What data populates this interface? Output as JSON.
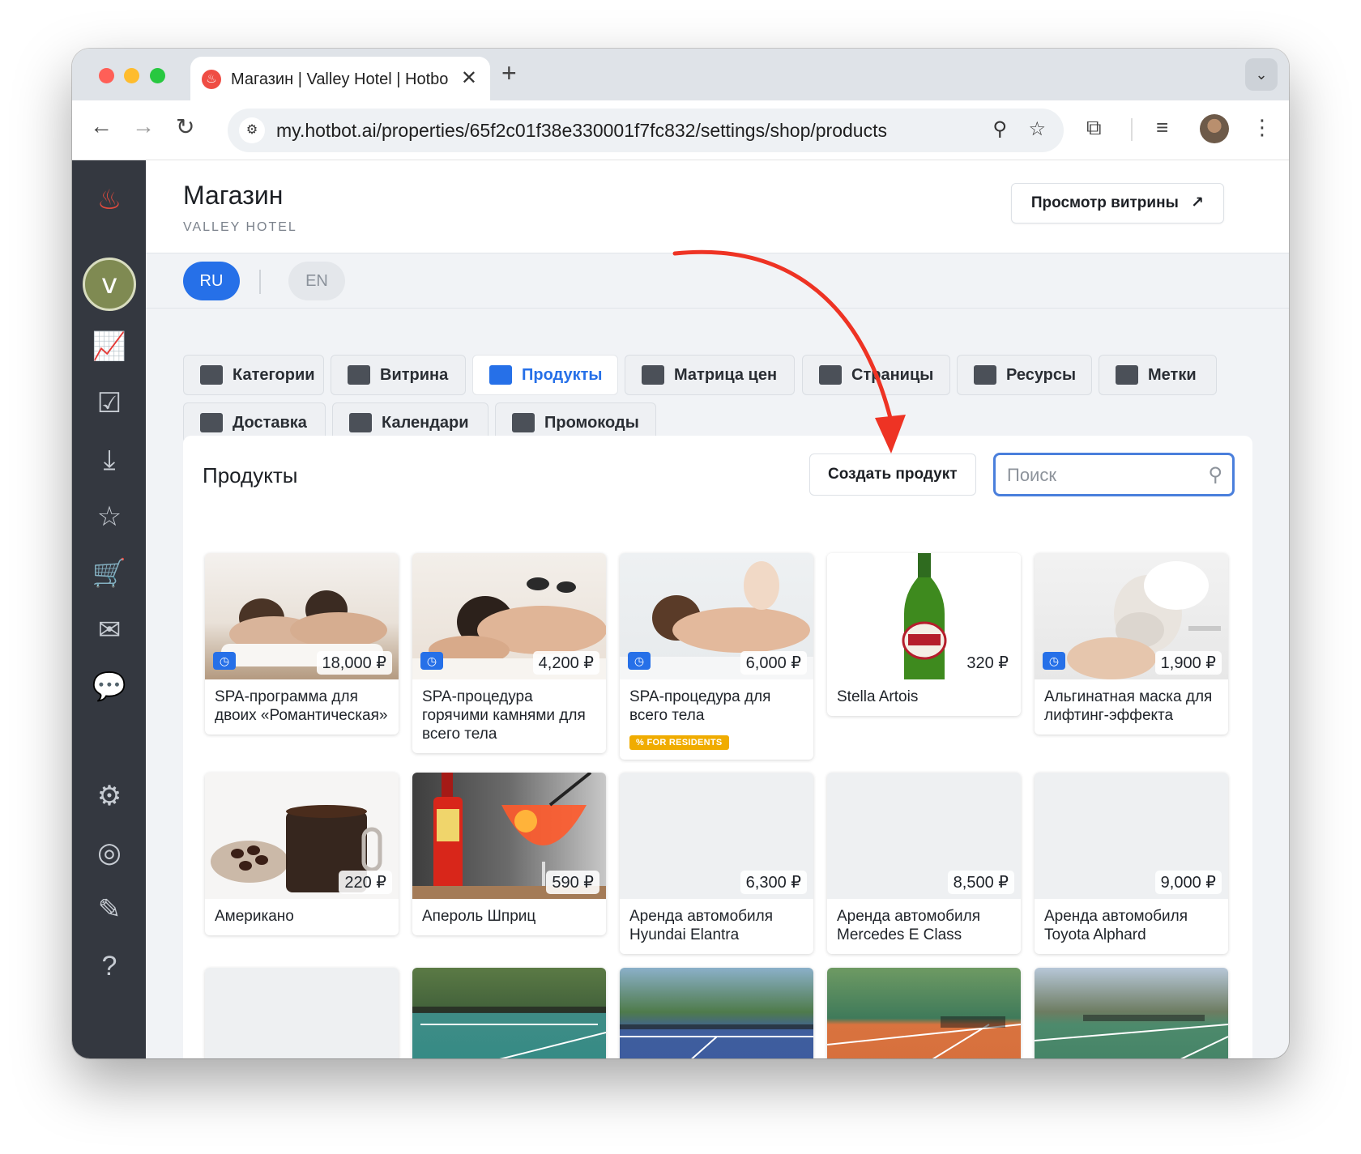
{
  "browser": {
    "tab_title": "Магазин | Valley Hotel | Hotbot",
    "url": "my.hotbot.ai/properties/65f2c01f38e330001f7fc832/settings/shop/products"
  },
  "page": {
    "title": "Магазин",
    "subtitle": "VALLEY HOTEL",
    "preview_button": "Просмотр витрины",
    "preview_arrow": "↗"
  },
  "languages": {
    "ru": "RU",
    "en": "EN"
  },
  "nav_tabs": [
    {
      "label": "Категории",
      "icon": "store-icon"
    },
    {
      "label": "Витрина",
      "icon": "showcase-icon"
    },
    {
      "label": "Продукты",
      "icon": "products-icon"
    },
    {
      "label": "Матрица цен",
      "icon": "price-matrix-icon"
    },
    {
      "label": "Страницы",
      "icon": "pages-icon"
    },
    {
      "label": "Ресурсы",
      "icon": "resources-icon"
    },
    {
      "label": "Метки",
      "icon": "tag-icon"
    },
    {
      "label": "Доставка",
      "icon": "truck-icon"
    },
    {
      "label": "Календари",
      "icon": "calendar-icon"
    },
    {
      "label": "Промокоды",
      "icon": "promo-icon"
    }
  ],
  "products_panel": {
    "title": "Продукты",
    "create_button": "Создать продукт",
    "search_placeholder": "Поиск"
  },
  "products": [
    {
      "name": "SPA-программа для двоих «Романтическая»",
      "price": "18,000 ₽",
      "timed": true,
      "image": "spa-couple"
    },
    {
      "name": "SPA-процедура горячими камнями для всего тела",
      "price": "4,200 ₽",
      "timed": true,
      "image": "hot-stones"
    },
    {
      "name": "SPA-процедура для всего тела",
      "price": "6,000 ₽",
      "timed": true,
      "badge": "FOR RESIDENTS",
      "image": "massage"
    },
    {
      "name": "Stella Artois",
      "price": "320 ₽",
      "timed": false,
      "image": "beer"
    },
    {
      "name": "Альгинатная маска для лифтинг-эффекта",
      "price": "1,900 ₽",
      "timed": true,
      "image": "face-mask"
    },
    {
      "name": "Американо",
      "price": "220 ₽",
      "timed": false,
      "image": "coffee"
    },
    {
      "name": "Апероль Шприц",
      "price": "590 ₽",
      "timed": false,
      "image": "aperol"
    },
    {
      "name": "Аренда автомобиля Hyundai Elantra",
      "price": "6,300 ₽",
      "timed": false,
      "image": "empty"
    },
    {
      "name": "Аренда автомобиля Mercedes E Class",
      "price": "8,500 ₽",
      "timed": false,
      "image": "empty"
    },
    {
      "name": "Аренда автомобиля Toyota Alphard",
      "price": "9,000 ₽",
      "timed": false,
      "image": "empty"
    }
  ],
  "colors": {
    "accent": "#2670e8",
    "sidebar": "#343840",
    "badge": "#f0ac00",
    "annotation_arrow": "#ee3324"
  }
}
